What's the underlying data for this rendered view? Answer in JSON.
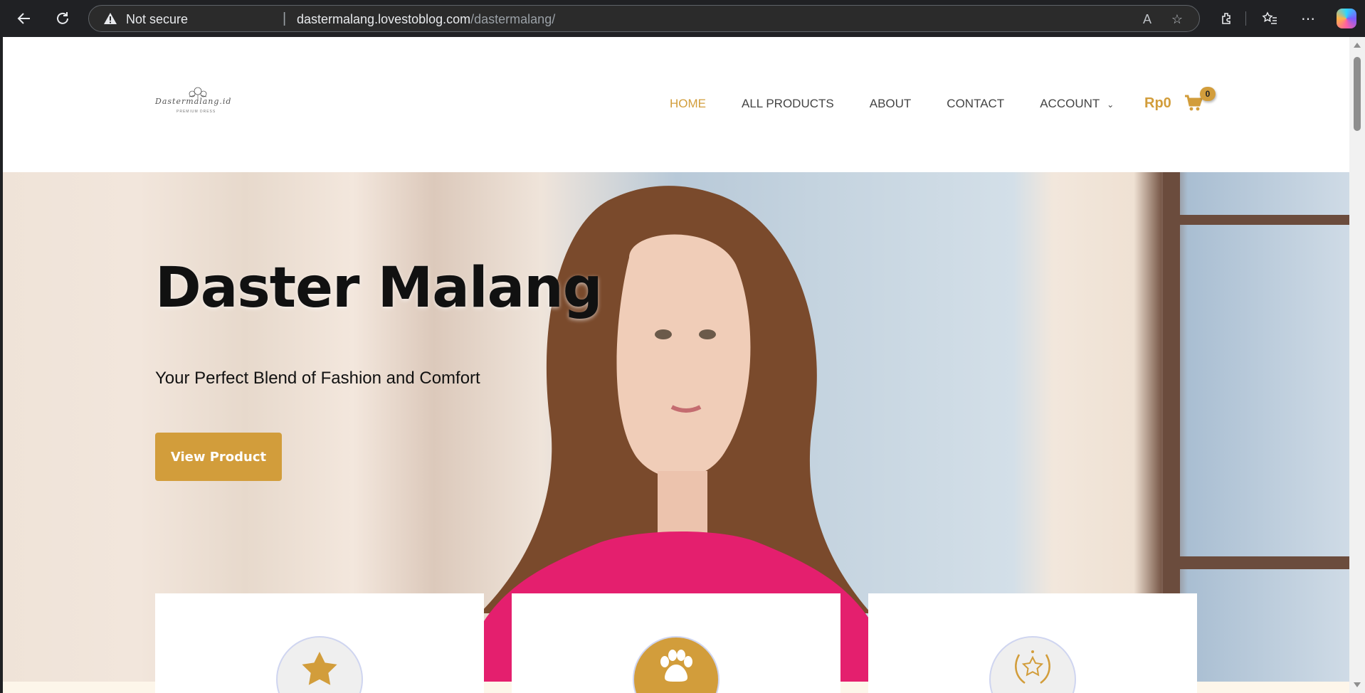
{
  "browser": {
    "security_label": "Not secure",
    "url_host": "dastermalang.lovestoblog.com",
    "url_path": "/dastermalang/",
    "icons": [
      "back-icon",
      "refresh-icon",
      "warning-icon",
      "read-aloud-icon",
      "favorite-star-icon",
      "extensions-icon",
      "favorites-icon",
      "more-icon",
      "copilot-icon"
    ]
  },
  "header": {
    "logo_text": "Dastermalang.id",
    "logo_sub": "PREMIUM DRESS",
    "nav": [
      {
        "label": "HOME",
        "active": true
      },
      {
        "label": "ALL PRODUCTS",
        "active": false
      },
      {
        "label": "ABOUT",
        "active": false
      },
      {
        "label": "CONTACT",
        "active": false
      },
      {
        "label": "ACCOUNT",
        "active": false
      }
    ],
    "cart_total": "Rp0",
    "cart_count": "0"
  },
  "hero": {
    "title": "Daster Malang",
    "tagline": "Your Perfect Blend of Fashion and Comfort",
    "cta_label": "View Product"
  },
  "features": [
    {
      "icon": "star-icon"
    },
    {
      "icon": "paw-icon"
    },
    {
      "icon": "laurel-star-icon"
    }
  ],
  "colors": {
    "accent": "#d29d3b"
  }
}
